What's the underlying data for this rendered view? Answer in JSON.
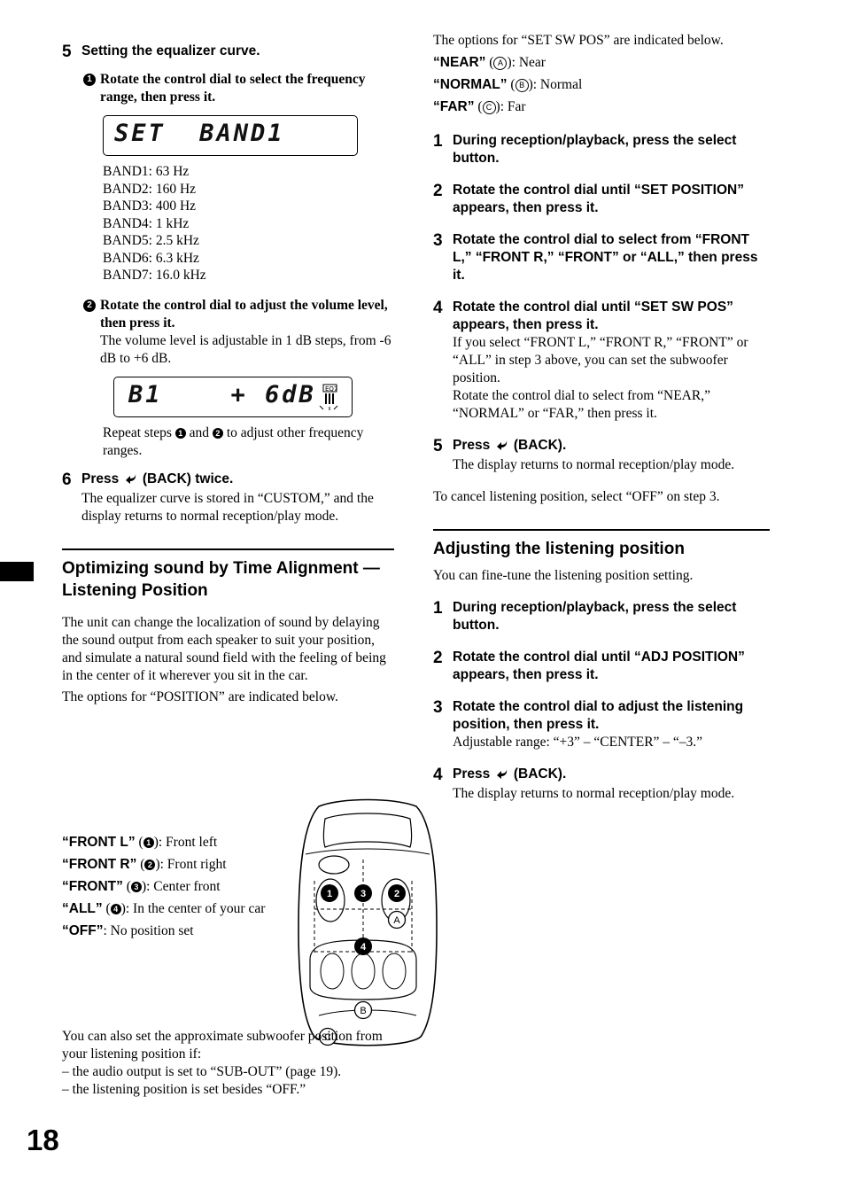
{
  "page": {
    "number": "18"
  },
  "left": {
    "step5": {
      "num": "5",
      "head": "Setting the equalizer curve.",
      "sub1": {
        "marker": "1",
        "head": "Rotate the control dial to select the frequency range, then press it."
      },
      "lcd1_text": "SET  BAND1",
      "bands": [
        "BAND1: 63 Hz",
        "BAND2: 160 Hz",
        "BAND3: 400 Hz",
        "BAND4: 1 kHz",
        "BAND5: 2.5 kHz",
        "BAND6: 6.3 kHz",
        "BAND7: 16.0 kHz"
      ],
      "sub2": {
        "marker": "2",
        "head": "Rotate the control dial to adjust the volume level, then press it.",
        "body": "The volume level is adjustable in 1 dB steps, from -6 dB to +6 dB."
      },
      "lcd2_text": "B1    + 6dB",
      "repeat_pre": "Repeat steps ",
      "repeat_mid": " and ",
      "repeat_post": " to adjust other frequency ranges.",
      "repeat_m1": "1",
      "repeat_m2": "2"
    },
    "step6": {
      "num": "6",
      "head_pre": "Press ",
      "head_post": " (BACK) twice.",
      "body": "The equalizer curve is stored in “CUSTOM,” and the display returns to normal reception/play mode."
    },
    "section": {
      "title": "Optimizing sound by Time Alignment — Listening Position",
      "para1": "The unit can change the localization of sound by delaying the sound output from each speaker to suit your position, and simulate a natural sound field with the feeling of being in the center of it wherever you sit in the car.",
      "para2": "The options for “POSITION” are indicated below."
    },
    "positions": [
      {
        "label": "“FRONT L”",
        "marker": "1",
        "desc": ": Front left"
      },
      {
        "label": "“FRONT R”",
        "marker": "2",
        "desc": ": Front right"
      },
      {
        "label": "“FRONT”",
        "marker": "3",
        "desc": ": Center front"
      },
      {
        "label": "“ALL”",
        "marker": "4",
        "desc": ": In the center of your car"
      },
      {
        "label": "“OFF”",
        "marker": "",
        "desc": ": No position set"
      }
    ],
    "after_fig": {
      "line1": "You can also set the approximate subwoofer position from your listening position if:",
      "line2": "– the audio output is set to “SUB-OUT” (page 19).",
      "line3": "– the listening position is set besides “OFF.”"
    },
    "car_figure": {
      "labels": [
        "1",
        "3",
        "2",
        "A",
        "4",
        "B",
        "C"
      ]
    }
  },
  "right": {
    "intro": {
      "para": "The options for “SET SW POS” are indicated below.",
      "options": [
        {
          "label": "“NEAR”",
          "marker": "A",
          "desc": ": Near"
        },
        {
          "label": "“NORMAL”",
          "marker": "B",
          "desc": ": Normal"
        },
        {
          "label": "“FAR”",
          "marker": "C",
          "desc": ": Far"
        }
      ]
    },
    "steps": [
      {
        "num": "1",
        "head": "During reception/playback, press the select button.",
        "body": ""
      },
      {
        "num": "2",
        "head": "Rotate the control dial until “SET POSITION” appears, then press it.",
        "body": ""
      },
      {
        "num": "3",
        "head": "Rotate the control dial to select from “FRONT L,” “FRONT R,” “FRONT” or “ALL,” then press it.",
        "body": ""
      },
      {
        "num": "4",
        "head": "Rotate the control dial until “SET SW POS” appears, then press it.",
        "body": "If you select “FRONT L,” “FRONT R,” “FRONT” or “ALL” in step 3 above, you can set the subwoofer position.\nRotate the control dial to select from “NEAR,” “NORMAL” or “FAR,” then press it."
      }
    ],
    "step5": {
      "num": "5",
      "head_pre": "Press ",
      "head_post": " (BACK).",
      "body": "The display returns to normal reception/play mode."
    },
    "cancel_note": "To cancel listening position, select “OFF” on step 3.",
    "section2": {
      "title": "Adjusting the listening position",
      "para": "You can fine-tune the listening position setting.",
      "steps": [
        {
          "num": "1",
          "head": "During reception/playback, press the select button.",
          "body": ""
        },
        {
          "num": "2",
          "head": "Rotate the control dial until “ADJ POSITION” appears, then press it.",
          "body": ""
        },
        {
          "num": "3",
          "head": "Rotate the control dial to adjust the listening position, then press it.",
          "body": "Adjustable range: “+3” – “CENTER” – “–3.”"
        }
      ],
      "step4": {
        "num": "4",
        "head_pre": "Press ",
        "head_post": " (BACK).",
        "body": "The display returns to normal reception/play mode."
      }
    }
  }
}
